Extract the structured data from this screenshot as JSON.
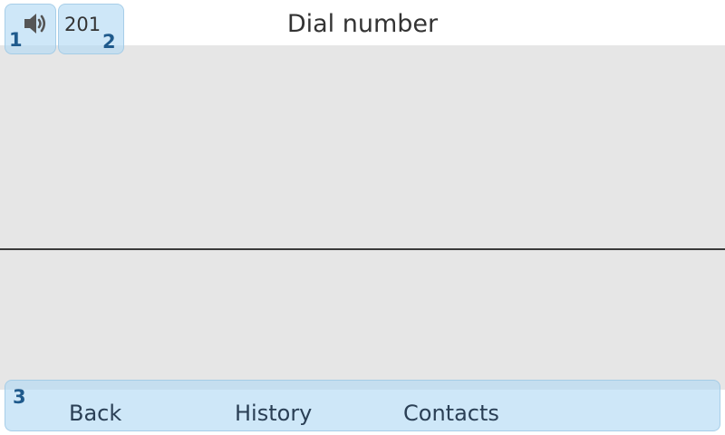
{
  "header": {
    "title": "Dial number",
    "speaker_icon": "speaker-icon",
    "line_label": "201"
  },
  "markers": {
    "speaker": "1",
    "line": "2",
    "softkeys": "3"
  },
  "softkeys": [
    {
      "label": "Back"
    },
    {
      "label": "History"
    },
    {
      "label": "Contacts"
    }
  ],
  "colors": {
    "highlight": "#b3daf4",
    "marker_text": "#1f5a8c",
    "content_bg": "#e6e6e6",
    "divider": "#3a3a3a"
  }
}
